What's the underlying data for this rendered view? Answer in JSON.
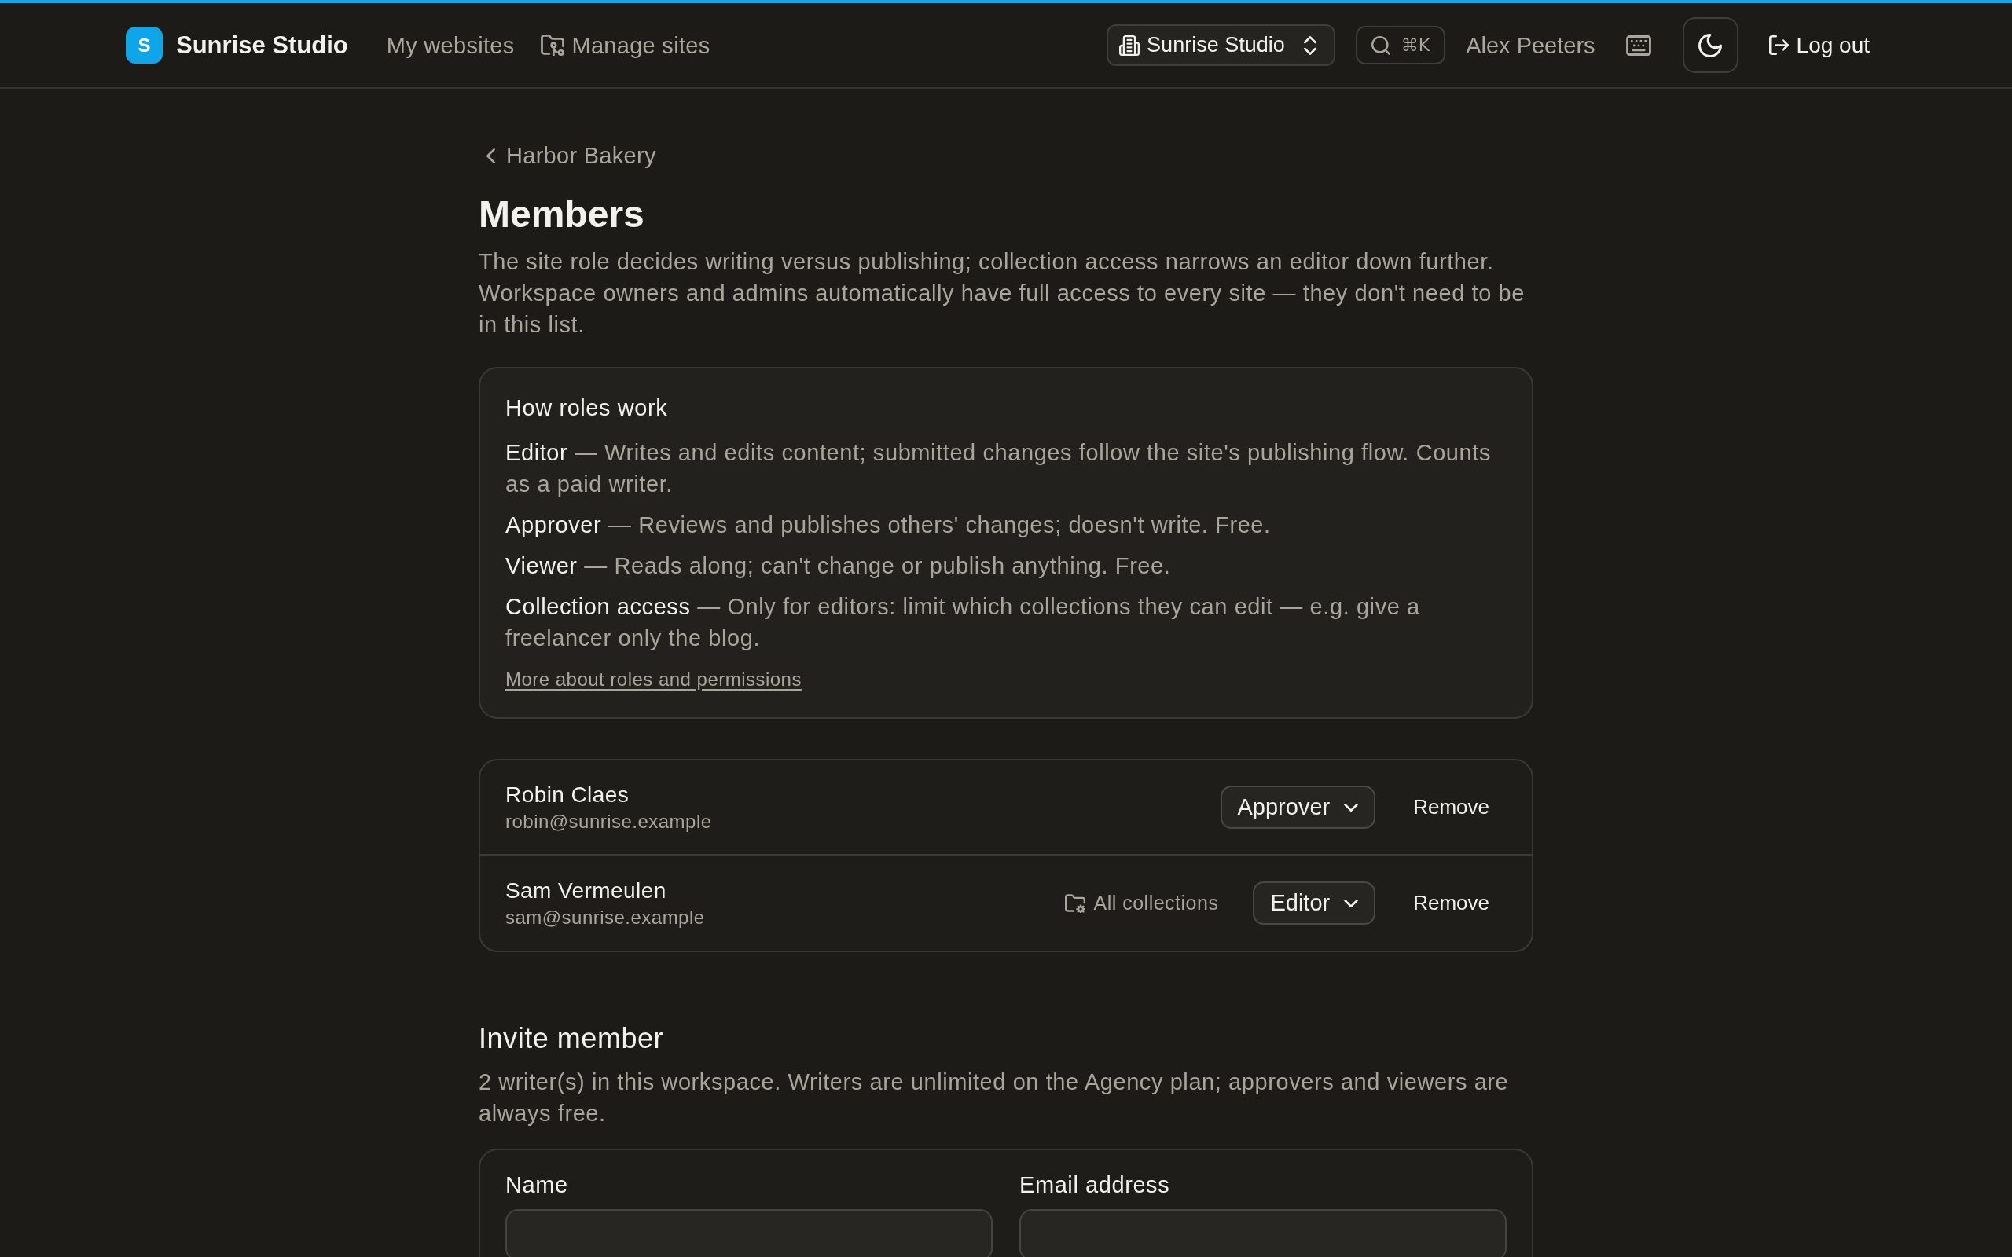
{
  "header": {
    "brand": {
      "initial": "S",
      "name": "Sunrise Studio"
    },
    "nav": [
      {
        "label": "My websites",
        "kind": "text"
      },
      {
        "label": "Manage sites",
        "kind": "with_icon"
      }
    ],
    "workspace_switcher": {
      "label": "Sunrise Studio"
    },
    "search": {
      "shortcut": "⌘K"
    },
    "user_name": "Alex Peeters",
    "logout": {
      "label": "Log out"
    }
  },
  "back_link": {
    "label": "Harbor Bakery"
  },
  "page": {
    "title": "Members",
    "description": "The site role decides writing versus publishing; collection access narrows an editor down further. Workspace owners and admins automatically have full access to every site — they don't need to be in this list."
  },
  "roles_info": {
    "title": "How roles work",
    "items": [
      "**Editor** — Writes and edits content; submitted changes follow the site's publishing flow. Counts as a paid writer.",
      "**Approver** — Reviews and publishes others' changes; doesn't write. Free.",
      "**Viewer** — Reads along; can't change or publish anything. Free.",
      "**Collection access** — Only for editors: limit which collections they can edit — e.g. give a freelancer only the blog."
    ],
    "link": "More about roles and permissions"
  },
  "members": [
    {
      "name": "Robin Claes",
      "email": "robin@sunrise.example",
      "role": "Approver",
      "remove": "Remove"
    },
    {
      "name": "Sam Vermeulen",
      "email": "sam@sunrise.example",
      "collection_access": "All collections",
      "role": "Editor",
      "remove": "Remove"
    }
  ],
  "invite": {
    "title": "Invite member",
    "note": "2 writer(s) in this workspace. Writers are unlimited on the Agency plan; approvers and viewers are always free.",
    "fields": [
      {
        "label": "Name"
      },
      {
        "label": "Email address"
      }
    ]
  }
}
